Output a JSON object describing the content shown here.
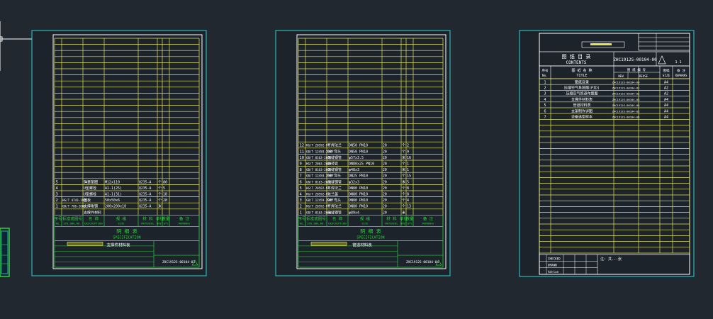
{
  "canvas": {
    "background": "#212830",
    "frame_color": "#2fd6d6",
    "grid_color": "#e6e65a",
    "title_block_color": "#2fcf3f",
    "text_color": "#ffffff"
  },
  "sheet1": {
    "rows": [
      {
        "no": "5",
        "code": "",
        "name": "弹簧垫圈",
        "spec": "M12x110",
        "mat": "Q235-A",
        "unit": "个",
        "qty": "80"
      },
      {
        "no": "4",
        "code": "",
        "name": "U型螺栓",
        "spec": "A1-1(25)",
        "mat": "Q235-A",
        "unit": "个",
        "qty": "5"
      },
      {
        "no": "3",
        "code": "",
        "name": "U型螺栓",
        "spec": "A1-1(31)",
        "mat": "Q235-A",
        "unit": "个",
        "qty": "18"
      },
      {
        "no": "2",
        "code": "HG/T 4743-1995",
        "name": "垫板",
        "spec": "50x50x6",
        "mat": "Q235-A",
        "unit": "个",
        "qty": "28"
      },
      {
        "no": "1",
        "code": "GB/T 706-2008",
        "name": "支撑角钢",
        "spec": "200x200x10",
        "mat": "Q235-A",
        "unit": "米",
        "qty": ""
      },
      {
        "no": "",
        "code": "",
        "name": "支撑件材料",
        "spec": "",
        "mat": "",
        "unit": "",
        "qty": ""
      }
    ],
    "table_title": "明 细 表",
    "table_title_en": "SPECIFICATION",
    "header_labels": [
      "序号\nNo.",
      "标准或图号\nSTD.DWG.NO.",
      "名 称\nDESCRIPTION",
      "规 格\nSIZE",
      "材 料\nMATERIAL",
      "单位\nUNIT",
      "数量\nQTY",
      "备 注\nREMARKS"
    ],
    "drawing_no": "ZHC1912S-00104-03",
    "block_title": "支撑件材料表"
  },
  "sheet2": {
    "rows": [
      {
        "no": "12",
        "code": "HG/T 20592-97",
        "name": "平焊法兰",
        "spec": "DN50 PN10",
        "mat": "20",
        "unit": "个",
        "qty": "2"
      },
      {
        "no": "11",
        "code": "GB/T 12459-2005",
        "name": "90°弯头",
        "spec": "DN50 PN10",
        "mat": "20",
        "unit": "个",
        "qty": "9"
      },
      {
        "no": "10",
        "code": "GB/T 8163-2008",
        "name": "无缝钢管",
        "spec": "φ57x3.5",
        "mat": "20",
        "unit": "米",
        "qty": "16"
      },
      {
        "no": "9",
        "code": "HG/T 2063-2008",
        "name": "异径管",
        "spec": "DN80x25 PN10",
        "mat": "20",
        "unit": "个",
        "qty": "1"
      },
      {
        "no": "8",
        "code": "GB/T 8163-2008",
        "name": "无缝钢管",
        "spec": "φ48x3",
        "mat": "20",
        "unit": "米",
        "qty": "1"
      },
      {
        "no": "7",
        "code": "GB/T 12459-2005",
        "name": "90°弯头",
        "spec": "DN25 PN10",
        "mat": "20",
        "unit": "个",
        "qty": "15"
      },
      {
        "no": "6",
        "code": "GB/T 8163-2008",
        "name": "无缝钢管",
        "spec": "φ32x3",
        "mat": "20",
        "unit": "米",
        "qty": "5"
      },
      {
        "no": "5",
        "code": "HG/T 20592-97",
        "name": "平焊法兰",
        "spec": "DN80 PN10",
        "mat": "20",
        "unit": "个",
        "qty": "8"
      },
      {
        "no": "4",
        "code": "HG/T 20592-97",
        "name": "法兰盖",
        "spec": "DN80 PN10",
        "mat": "20",
        "unit": "个",
        "qty": "8"
      },
      {
        "no": "3",
        "code": "GB/T 12459-2005",
        "name": "90°弯头",
        "spec": "DN80 PN10",
        "mat": "20",
        "unit": "个",
        "qty": "4"
      },
      {
        "no": "2",
        "code": "HG/T 20592-97",
        "name": "平焊法兰",
        "spec": "DN80 PN10",
        "mat": "20",
        "unit": "个",
        "qty": "13"
      },
      {
        "no": "1",
        "code": "GB/T 8163-2008",
        "name": "无缝钢管",
        "spec": "φ89x4",
        "mat": "20",
        "unit": "米",
        "qty": ""
      }
    ],
    "table_title": "明 细 表",
    "table_title_en": "SPECIFICATION",
    "header_labels": [
      "序号\nNo.",
      "标准或图号\nSTD.DWG.NO.",
      "名 称\nDESCRIPTION",
      "规 格\nSIZE",
      "材 料\nMATERIAL",
      "单位\nUNIT",
      "数量\nQTY",
      "备 注\nREMARKS"
    ],
    "drawing_no": "ZHC1912S-00104-04",
    "block_title": "管道材料表"
  },
  "sheet3": {
    "title_cn": "图 纸 目 录",
    "title_en": "CONTENTS",
    "drawing_no": "ZHC1912S-00104-00",
    "col_no": "序号\nNo.",
    "col_title": "图 纸 名 称\nTITLE",
    "col_dwg": "图 纸 编 号\nDRAWING NO.",
    "col_old": "旧 图\nOLD",
    "col_new": "新 图\nNEW",
    "col_reuse": "复用图\nREUSE",
    "col_size": "图幅\nSIZE",
    "col_remarks": "备 注\nREMARKS",
    "rows": [
      {
        "no": "1",
        "title": "图纸目录",
        "dwg": "ZHC1912S-00104-00",
        "size": "A4"
      },
      {
        "no": "2",
        "title": "压缩空气系统图(PID)",
        "dwg": "ZHC1912S-00104-01",
        "size": "A2"
      },
      {
        "no": "3",
        "title": "压缩空气管道布置图",
        "dwg": "ZHC1912S-00104-02",
        "size": "A2"
      },
      {
        "no": "4",
        "title": "支撑件材料表",
        "dwg": "ZHC1912S-00104-03",
        "size": "A4"
      },
      {
        "no": "5",
        "title": "管道材料表",
        "dwg": "ZHC1912S-00104-04",
        "size": "A4"
      },
      {
        "no": "6",
        "title": "支架制作详图",
        "dwg": "ZHC1912S-00104-05",
        "size": "A4"
      },
      {
        "no": "7",
        "title": "设备选型样本",
        "dwg": "ZHC1912S-00104-06",
        "size": "A4"
      }
    ],
    "sign_labels": [
      "CHECKED",
      "DRAWN",
      "Adrian"
    ],
    "note": "注: 共...张",
    "revision": "1 1"
  }
}
